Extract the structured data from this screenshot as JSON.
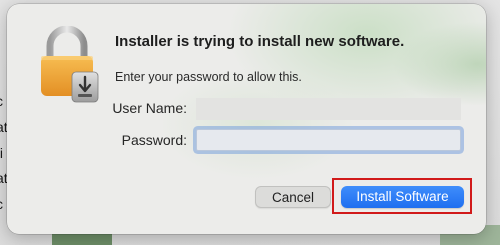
{
  "background": {
    "text_fragments": [
      "c",
      "at",
      "ti",
      "at",
      "c"
    ]
  },
  "dialog": {
    "icon": "lock-icon",
    "title": "Installer is trying to install new software.",
    "subtitle": "Enter your password to allow this.",
    "user_name": {
      "label": "User Name:",
      "value": ""
    },
    "password": {
      "label": "Password:",
      "value": ""
    },
    "buttons": {
      "cancel": "Cancel",
      "install": "Install Software"
    }
  },
  "colors": {
    "primary_button": "#2a7bf6",
    "highlight_border": "#d11a1a",
    "lock_gold": "#f0a83a"
  }
}
